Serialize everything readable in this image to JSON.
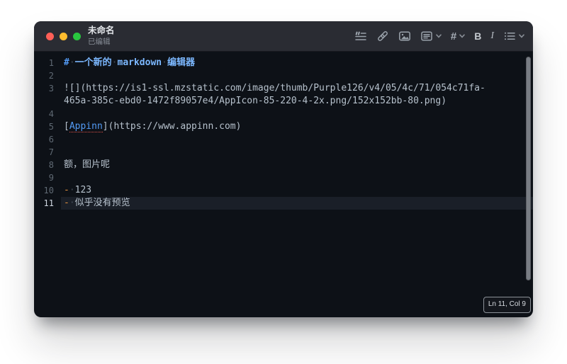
{
  "window": {
    "title": "未命名",
    "subtitle": "已编辑"
  },
  "toolbar": {
    "heading_glyph": "#",
    "bold_label": "B",
    "italic_label": "I",
    "icons": [
      "blockquote",
      "link",
      "image",
      "insert-panel",
      "heading",
      "bold",
      "italic",
      "bullet-list"
    ]
  },
  "editor": {
    "status_line": "Ln 11, Col 9",
    "rows": [
      {
        "num": "1",
        "tokens": [
          {
            "t": "#",
            "s": "hash"
          },
          {
            "t": " ",
            "s": "sp"
          },
          {
            "t": "一个新的",
            "s": "h1"
          },
          {
            "t": " ",
            "s": "sp"
          },
          {
            "t": "markdown",
            "s": "h1"
          },
          {
            "t": " ",
            "s": "sp"
          },
          {
            "t": "编辑器",
            "s": "h1"
          }
        ]
      },
      {
        "num": "2",
        "tokens": []
      },
      {
        "num": "3",
        "tokens": [
          {
            "t": "![](https://is1-ssl.mzstatic.com/image/thumb/Purple126/v4/05/4c/71/054c71fa-",
            "s": "txt"
          }
        ]
      },
      {
        "num": "",
        "tokens": [
          {
            "t": "465a-385c-ebd0-1472f89057e4/AppIcon-85-220-4-2x.png/152x152bb-80.png)",
            "s": "txt"
          }
        ]
      },
      {
        "num": "4",
        "tokens": []
      },
      {
        "num": "5",
        "tokens": [
          {
            "t": "[",
            "s": "txt"
          },
          {
            "t": "Appinn",
            "s": "link"
          },
          {
            "t": "](https://www.appinn.com)",
            "s": "txt"
          }
        ]
      },
      {
        "num": "6",
        "tokens": []
      },
      {
        "num": "7",
        "tokens": []
      },
      {
        "num": "8",
        "tokens": [
          {
            "t": "额，图片呢",
            "s": "txt"
          }
        ]
      },
      {
        "num": "9",
        "tokens": []
      },
      {
        "num": "10",
        "tokens": [
          {
            "t": "-",
            "s": "bullet"
          },
          {
            "t": " ",
            "s": "sp"
          },
          {
            "t": "123",
            "s": "txt"
          }
        ]
      },
      {
        "num": "11",
        "current": true,
        "tokens": [
          {
            "t": "-",
            "s": "bullet"
          },
          {
            "t": " ",
            "s": "sp"
          },
          {
            "t": "似乎没有预览",
            "s": "txt"
          }
        ]
      }
    ]
  },
  "colors": {
    "titlebar_bg": "#2a2c33",
    "editor_bg": "#0d1117",
    "current_line_bg": "#1a1f28",
    "heading_text": "#7cb8ff",
    "accent_blue": "#539bf5",
    "bullet_orange": "#e0903f",
    "spellcheck_red": "#e5534b",
    "plain_text": "#b6c1cc",
    "traffic_red": "#ff5f57",
    "traffic_yellow": "#febc2e",
    "traffic_green": "#29c73f"
  }
}
